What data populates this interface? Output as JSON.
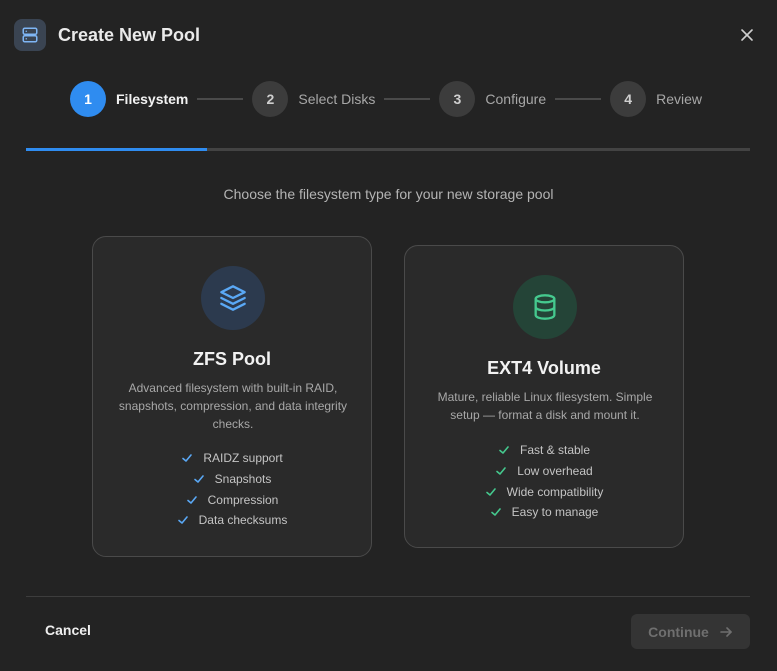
{
  "header": {
    "title": "Create New Pool",
    "icon": "server-icon"
  },
  "steps": [
    {
      "number": "1",
      "label": "Filesystem",
      "active": true
    },
    {
      "number": "2",
      "label": "Select Disks",
      "active": false
    },
    {
      "number": "3",
      "label": "Configure",
      "active": false
    },
    {
      "number": "4",
      "label": "Review",
      "active": false
    }
  ],
  "progress": {
    "fraction": 0.25
  },
  "subtitle": "Choose the filesystem type for your new storage pool",
  "options": {
    "zfs": {
      "title": "ZFS Pool",
      "description": "Advanced filesystem with built-in RAID, snapshots, compression, and data integrity checks.",
      "icon": "layers-icon",
      "accent": "#5aa8f5",
      "features": [
        "RAIDZ support",
        "Snapshots",
        "Compression",
        "Data checksums"
      ]
    },
    "ext4": {
      "title": "EXT4 Volume",
      "description": "Mature, reliable Linux filesystem. Simple setup — format a disk and mount it.",
      "icon": "database-icon",
      "accent": "#45c98e",
      "features": [
        "Fast & stable",
        "Low overhead",
        "Wide compatibility",
        "Easy to manage"
      ]
    }
  },
  "footer": {
    "cancel_label": "Cancel",
    "continue_label": "Continue"
  },
  "colors": {
    "primary": "#2f8cf0",
    "check_blue": "#5aa8f5",
    "check_green": "#45c98e"
  }
}
